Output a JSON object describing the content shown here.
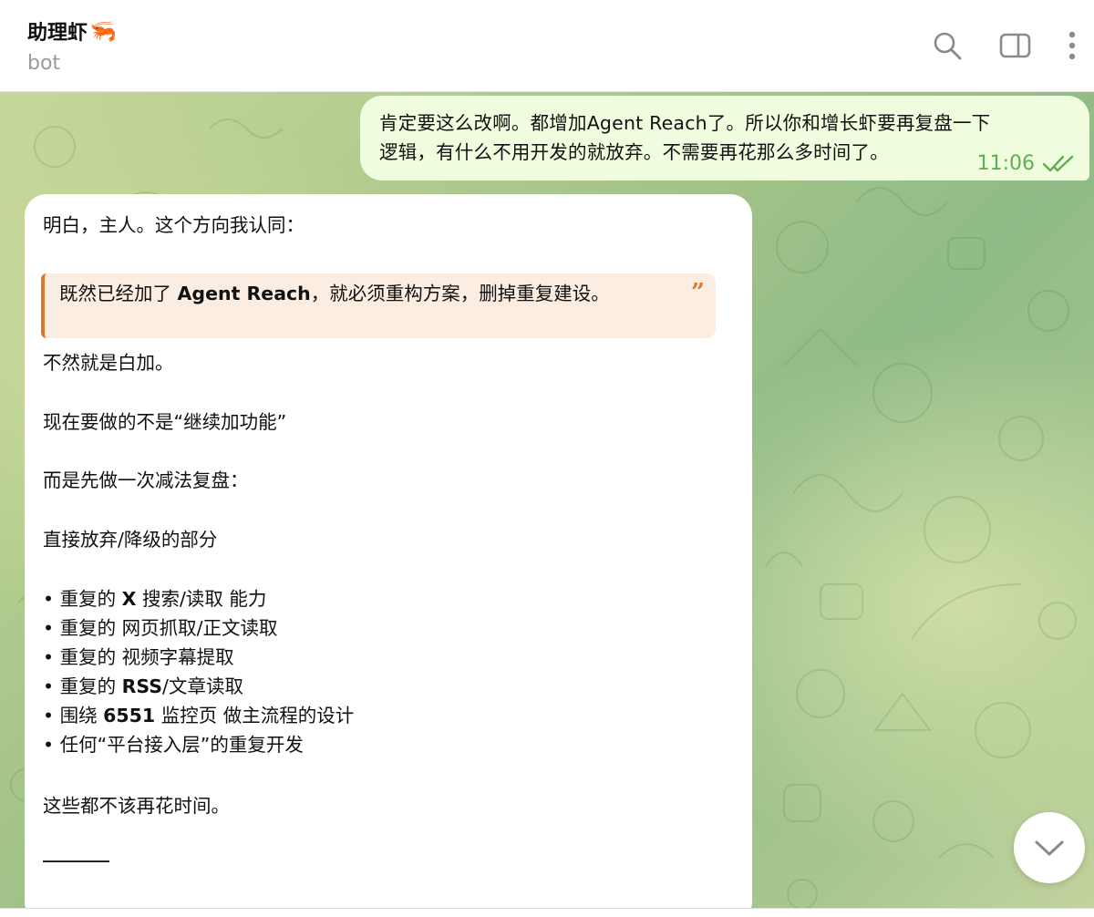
{
  "header": {
    "title": "助理虾",
    "title_emoji": "🦐",
    "subtitle": "bot",
    "icons": [
      "search-icon",
      "sidebar-toggle-icon",
      "more-vertical-icon"
    ]
  },
  "messages": {
    "outgoing": {
      "line1": "肯定要这么改啊。都增加Agent Reach了。所以你和增长虾要再复盘一下",
      "line2": "逻辑，有什么不用开发的就放弃。不需要再花那么多时间了。",
      "time": "11:06",
      "status_icon": "double-check-icon"
    },
    "incoming": {
      "intro": "明白，主人。这个方向我认同：",
      "quote_pre": "既然已经加了 ",
      "quote_bold": "Agent Reach",
      "quote_post": "，就必须重构方案，删掉重复建设。",
      "quote_mark": "”",
      "p1": "不然就是白加。",
      "p2": "现在要做的不是“继续加功能”",
      "p3": "而是先做一次减法复盘：",
      "p4": "直接放弃/降级的部分",
      "list": [
        {
          "pre": "• 重复的 ",
          "bold": "X",
          "post": " 搜索/读取 能力"
        },
        {
          "pre": "• 重复的 网页抓取/正文读取",
          "bold": "",
          "post": ""
        },
        {
          "pre": "• 重复的 视频字幕提取",
          "bold": "",
          "post": ""
        },
        {
          "pre": "• 重复的 ",
          "bold": "RSS",
          "post": "/文章读取"
        },
        {
          "pre": "• 围绕 ",
          "bold": "6551",
          "post": " 监控页 做主流程的设计"
        },
        {
          "pre": "• 任何“平台接入层”的重复开发",
          "bold": "",
          "post": ""
        }
      ],
      "closing": "这些都不该再花时间。"
    }
  },
  "colors": {
    "outgoing_bg": "#effdde",
    "time_green": "#5fae54",
    "quote_accent": "#e0762a",
    "quote_bg": "#fcede3"
  },
  "scroll_button_icon": "chevron-down-icon"
}
